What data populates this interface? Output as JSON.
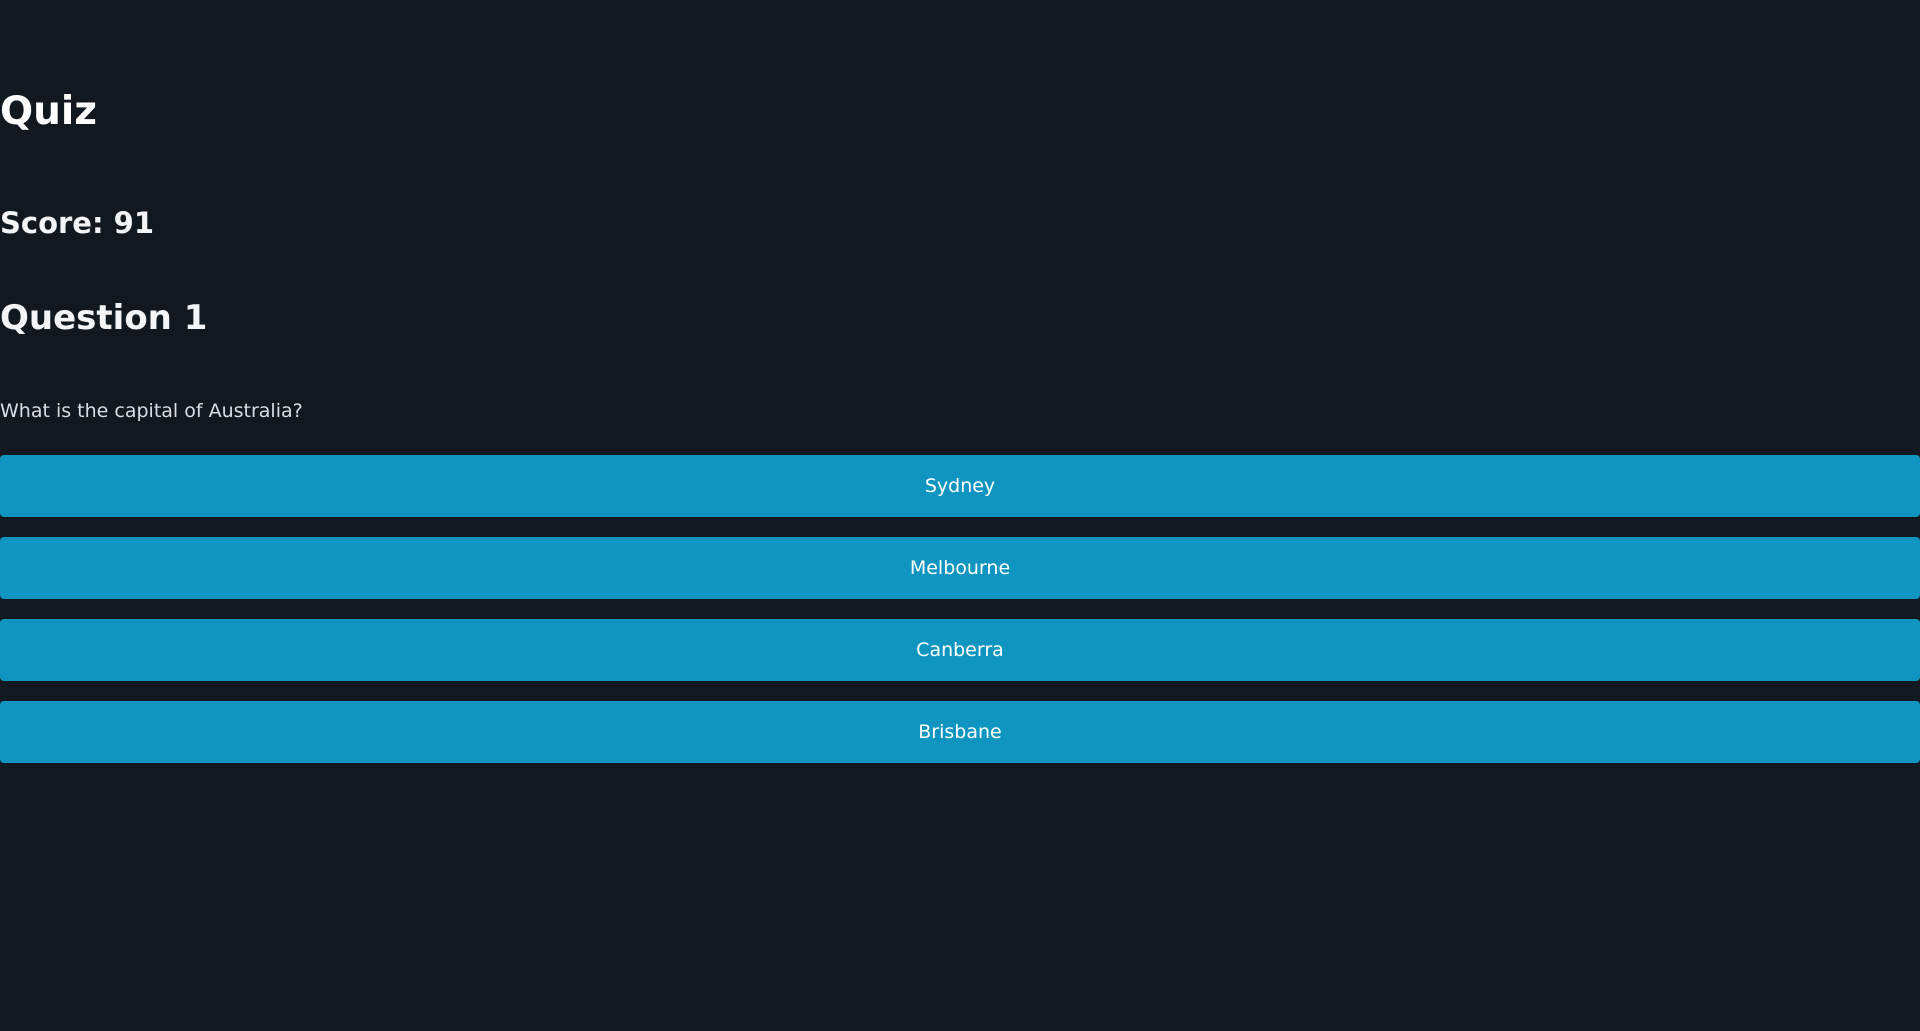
{
  "quiz": {
    "title": "Quiz",
    "score_text": "Score: 91",
    "question_heading": "Question 1",
    "question_text": "What is the capital of Australia?",
    "answers": [
      {
        "label": "Sydney"
      },
      {
        "label": "Melbourne"
      },
      {
        "label": "Canberra"
      },
      {
        "label": "Brisbane"
      }
    ]
  },
  "theme": {
    "background": "#111820",
    "button": "#1095c1",
    "text": "#ffffff"
  }
}
